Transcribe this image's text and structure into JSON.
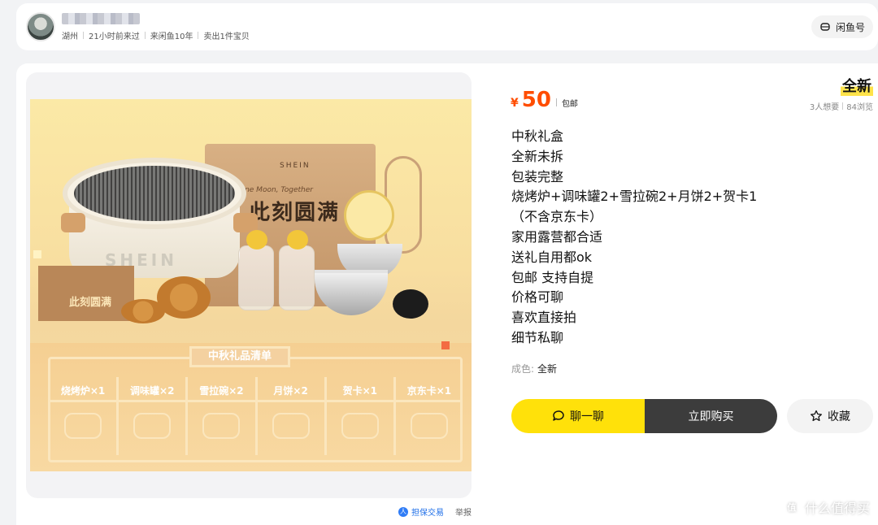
{
  "seller": {
    "location": "湖州",
    "last_seen": "21小时前来过",
    "member_since": "来闲鱼10年",
    "sold": "卖出1件宝贝",
    "xianyu_button": "闲鱼号"
  },
  "product_image": {
    "box_brand": "SHEIN",
    "box_tagline": "One Moon, Together",
    "box_title": "此刻圆满",
    "grill_logo": "SHEIN",
    "small_box_title": "此刻圆满",
    "gift_list_title": "中秋礼品清单",
    "gift_list": [
      {
        "label": "烧烤炉×1"
      },
      {
        "label": "调味罐×2"
      },
      {
        "label": "雪拉碗×2"
      },
      {
        "label": "月饼×2"
      },
      {
        "label": "贺卡×1"
      },
      {
        "label": "京东卡×1"
      }
    ],
    "guarantee_label": "担保交易",
    "report_label": "举报"
  },
  "listing": {
    "currency": "¥",
    "price": "50",
    "shipping": "包邮",
    "condition_badge": "全新",
    "wants": "3人想要",
    "views": "84浏览",
    "description": [
      "中秋礼盒",
      "全新未拆",
      "包装完整",
      "烧烤炉+调味罐2+雪拉碗2+月饼2+贺卡1",
      "（不含京东卡）",
      "家用露营都合适",
      "送礼自用都ok",
      "包邮 支持自提",
      "价格可聊",
      "喜欢直接拍",
      "细节私聊"
    ],
    "condition_key": "成色:",
    "condition_value": "全新"
  },
  "actions": {
    "chat": "聊一聊",
    "buy": "立即购买",
    "favorite": "收藏"
  },
  "watermark": "什么值得买",
  "colors": {
    "price": "#ff4d00",
    "chat_button": "#ffe10a",
    "buy_button": "#3c3c3c",
    "guarantee": "#1f6fe8"
  }
}
